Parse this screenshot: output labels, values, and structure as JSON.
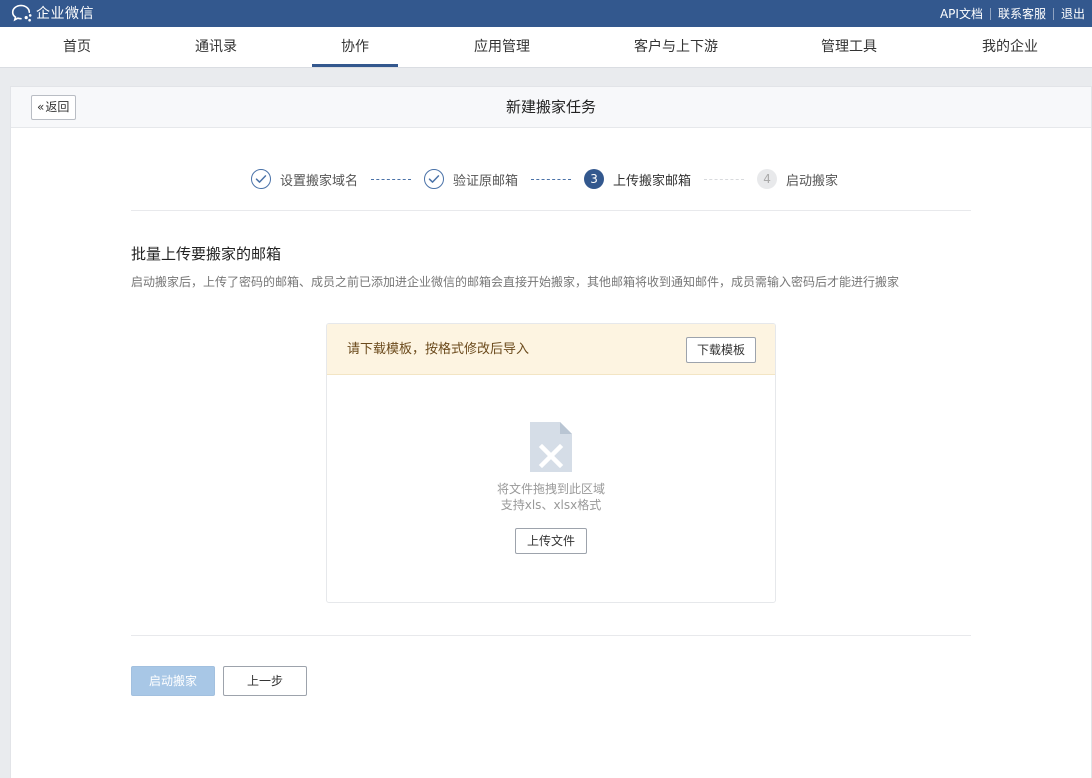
{
  "app": {
    "name": "企业微信",
    "logo_icon": "chat-bubble-logo-icon"
  },
  "top_links": [
    {
      "label": "API文档"
    },
    {
      "label": "联系客服"
    },
    {
      "label": "退出"
    }
  ],
  "nav": {
    "items": [
      {
        "label": "首页",
        "active": false
      },
      {
        "label": "通讯录",
        "active": false
      },
      {
        "label": "协作",
        "active": true
      },
      {
        "label": "应用管理",
        "active": false
      },
      {
        "label": "客户与上下游",
        "active": false
      },
      {
        "label": "管理工具",
        "active": false
      },
      {
        "label": "我的企业",
        "active": false
      }
    ]
  },
  "page": {
    "back_label": "返回",
    "title": "新建搬家任务"
  },
  "steps": [
    {
      "number": "",
      "label": "设置搬家域名",
      "state": "done"
    },
    {
      "number": "",
      "label": "验证原邮箱",
      "state": "done"
    },
    {
      "number": "3",
      "label": "上传搬家邮箱",
      "state": "current"
    },
    {
      "number": "4",
      "label": "启动搬家",
      "state": "todo"
    }
  ],
  "section": {
    "title": "批量上传要搬家的邮箱",
    "description": "启动搬家后，上传了密码的邮箱、成员之前已添加进企业微信的邮箱会直接开始搬家，其他邮箱将收到通知邮件，成员需输入密码后才能进行搬家"
  },
  "upload": {
    "tip": "请下载模板，按格式修改后导入",
    "download_label": "下载模板",
    "drop_hint": "将文件拖拽到此区域",
    "format_hint": "支持xls、xlsx格式",
    "upload_label": "上传文件",
    "file_icon": "excel-file-icon"
  },
  "actions": {
    "start_label": "启动搬家",
    "prev_label": "上一步"
  },
  "colors": {
    "header_bg": "#33588e",
    "accent": "#33588e",
    "tip_bg": "#fdf4e1",
    "disabled_primary": "#a8c7e6"
  }
}
